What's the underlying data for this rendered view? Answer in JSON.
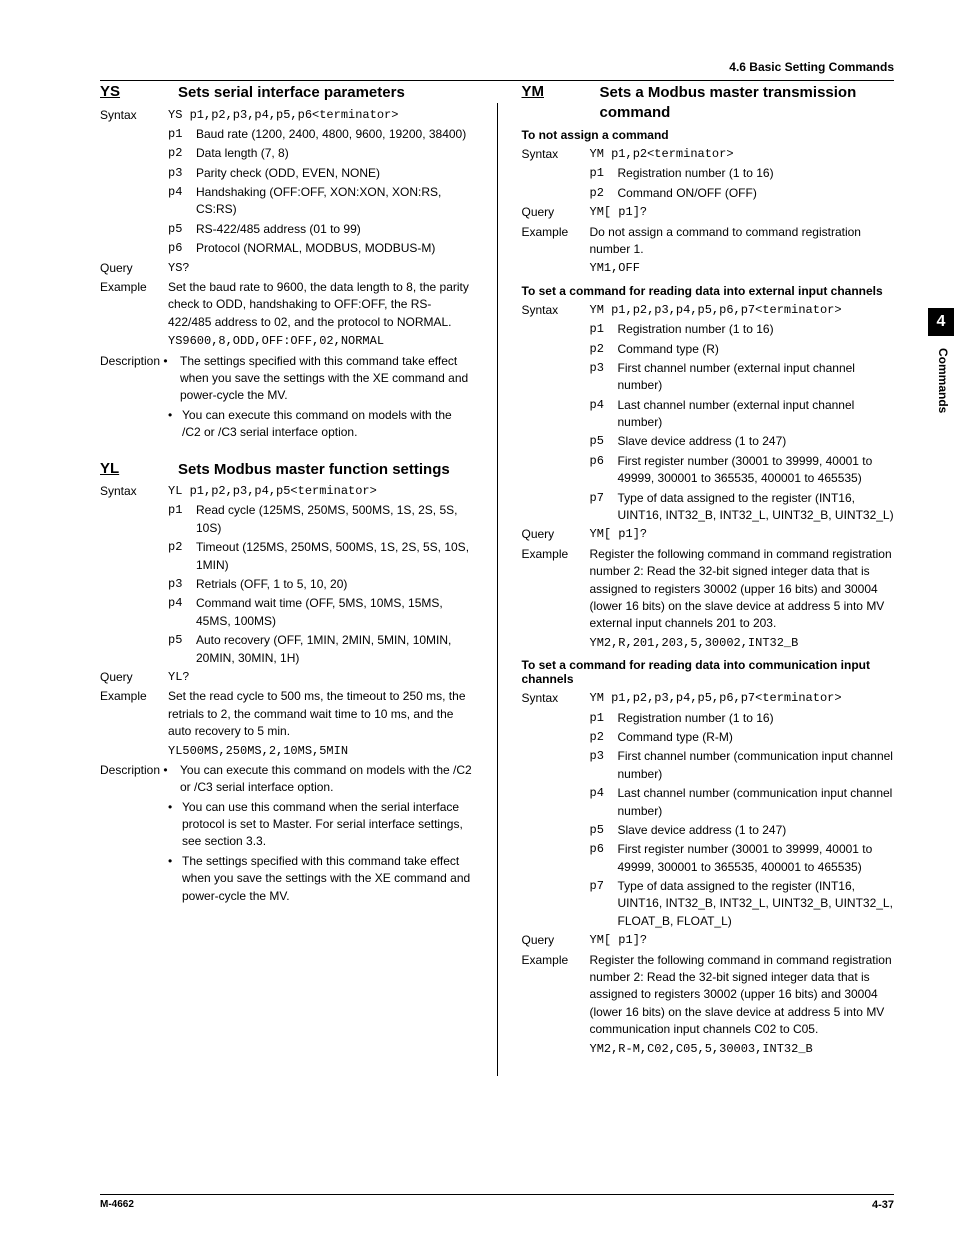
{
  "header": "4.6  Basic Setting Commands",
  "side_tab": "4",
  "side_label": "Commands",
  "footer_left": "M-4662",
  "footer_right": "4-37",
  "left": {
    "ys": {
      "name": "YS",
      "title": "Sets serial interface parameters",
      "syntax_label": "Syntax",
      "syntax": "YS p1,p2,p3,p4,p5,p6<terminator>",
      "params": [
        {
          "p": "p1",
          "t": "Baud rate (1200, 2400, 4800, 9600, 19200, 38400)"
        },
        {
          "p": "p2",
          "t": "Data length (7, 8)"
        },
        {
          "p": "p3",
          "t": "Parity check (ODD, EVEN, NONE)"
        },
        {
          "p": "p4",
          "t": "Handshaking (OFF:OFF, XON:XON, XON:RS, CS:RS)"
        },
        {
          "p": "p5",
          "t": "RS-422/485 address (01 to 99)"
        },
        {
          "p": "p6",
          "t": "Protocol (NORMAL, MODBUS, MODBUS-M)"
        }
      ],
      "query_label": "Query",
      "query": "YS?",
      "example_label": "Example",
      "example_text": "Set the baud rate to 9600, the data length to 8, the parity check to ODD, handshaking to OFF:OFF, the RS-422/485 address to 02, and the protocol to NORMAL.",
      "example_code": "YS9600,8,ODD,OFF:OFF,02,NORMAL",
      "desc_label": "Description •",
      "desc1": "The settings specified with this command take effect when you save the settings with the XE command and power-cycle the MV.",
      "desc2": "You can execute this command on models with the /C2 or /C3 serial interface option."
    },
    "yl": {
      "name": "YL",
      "title": "Sets Modbus master function settings",
      "syntax_label": "Syntax",
      "syntax": "YL p1,p2,p3,p4,p5<terminator>",
      "params": [
        {
          "p": "p1",
          "t": "Read cycle (125MS, 250MS, 500MS, 1S, 2S, 5S, 10S)"
        },
        {
          "p": "p2",
          "t": "Timeout (125MS, 250MS, 500MS, 1S, 2S, 5S, 10S, 1MIN)"
        },
        {
          "p": "p3",
          "t": "Retrials (OFF, 1 to 5, 10, 20)"
        },
        {
          "p": "p4",
          "t": "Command wait time (OFF, 5MS, 10MS, 15MS, 45MS, 100MS)"
        },
        {
          "p": "p5",
          "t": "Auto recovery (OFF, 1MIN, 2MIN, 5MIN, 10MIN, 20MIN, 30MIN, 1H)"
        }
      ],
      "query_label": "Query",
      "query": "YL?",
      "example_label": "Example",
      "example_text": "Set the read cycle to 500 ms, the timeout to 250 ms, the retrials to 2, the command wait time to 10 ms, and the auto recovery to 5 min.",
      "example_code": "YL500MS,250MS,2,10MS,5MIN",
      "desc_label": "Description •",
      "desc1": "You can execute this command on models with the /C2 or /C3 serial interface option.",
      "desc2": "You can use this command when the serial interface protocol is set to Master. For serial interface settings, see section 3.3.",
      "desc3": "The settings specified with this command take effect when you save the settings with the XE command and power-cycle the MV."
    }
  },
  "right": {
    "ym": {
      "name": "YM",
      "title": "Sets a Modbus master transmission command",
      "sec1": {
        "heading": "To not assign a command",
        "syntax_label": "Syntax",
        "syntax": "YM p1,p2<terminator>",
        "params": [
          {
            "p": "p1",
            "t": "Registration number (1 to 16)"
          },
          {
            "p": "p2",
            "t": "Command ON/OFF (OFF)"
          }
        ],
        "query_label": "Query",
        "query": "YM[ p1]?",
        "example_label": "Example",
        "example_text": "Do not assign a command to command registration number 1.",
        "example_code": "YM1,OFF"
      },
      "sec2": {
        "heading": "To set a command for reading data into external input channels",
        "syntax_label": "Syntax",
        "syntax": "YM p1,p2,p3,p4,p5,p6,p7<terminator>",
        "params": [
          {
            "p": "p1",
            "t": "Registration number (1 to 16)"
          },
          {
            "p": "p2",
            "t": "Command type (R)"
          },
          {
            "p": "p3",
            "t": "First channel number (external input channel number)"
          },
          {
            "p": "p4",
            "t": "Last channel number (external input channel number)"
          },
          {
            "p": "p5",
            "t": "Slave device address (1 to 247)"
          },
          {
            "p": "p6",
            "t": "First register number (30001 to 39999, 40001 to 49999, 300001 to 365535, 400001 to 465535)"
          },
          {
            "p": "p7",
            "t": "Type of data assigned to the register (INT16, UINT16, INT32_B, INT32_L, UINT32_B, UINT32_L)"
          }
        ],
        "query_label": "Query",
        "query": "YM[ p1]?",
        "example_label": "Example",
        "example_text": "Register the following command in command registration number 2: Read the 32-bit signed integer data that is assigned to registers 30002 (upper 16 bits) and 30004 (lower 16 bits) on the slave device at address 5 into MV external input channels 201 to 203.",
        "example_code": "YM2,R,201,203,5,30002,INT32_B"
      },
      "sec3": {
        "heading": "To set a command for reading data into communication input channels",
        "syntax_label": "Syntax",
        "syntax": "YM p1,p2,p3,p4,p5,p6,p7<terminator>",
        "params": [
          {
            "p": "p1",
            "t": "Registration number (1 to 16)"
          },
          {
            "p": "p2",
            "t": "Command type (R-M)"
          },
          {
            "p": "p3",
            "t": "First channel number (communication input channel number)"
          },
          {
            "p": "p4",
            "t": "Last channel number (communication input channel number)"
          },
          {
            "p": "p5",
            "t": "Slave device address (1 to 247)"
          },
          {
            "p": "p6",
            "t": "First register number (30001 to 39999, 40001 to 49999, 300001 to 365535, 400001 to 465535)"
          },
          {
            "p": "p7",
            "t": "Type of data assigned to the register (INT16, UINT16, INT32_B, INT32_L, UINT32_B, UINT32_L, FLOAT_B, FLOAT_L)"
          }
        ],
        "query_label": "Query",
        "query": "YM[ p1]?",
        "example_label": "Example",
        "example_text": "Register the following command in command registration number 2: Read the 32-bit signed integer data that is assigned to registers 30002 (upper 16 bits) and 30004 (lower 16 bits) on the slave device at address 5 into MV communication input channels C02 to C05.",
        "example_code": "YM2,R-M,C02,C05,5,30003,INT32_B"
      }
    }
  }
}
